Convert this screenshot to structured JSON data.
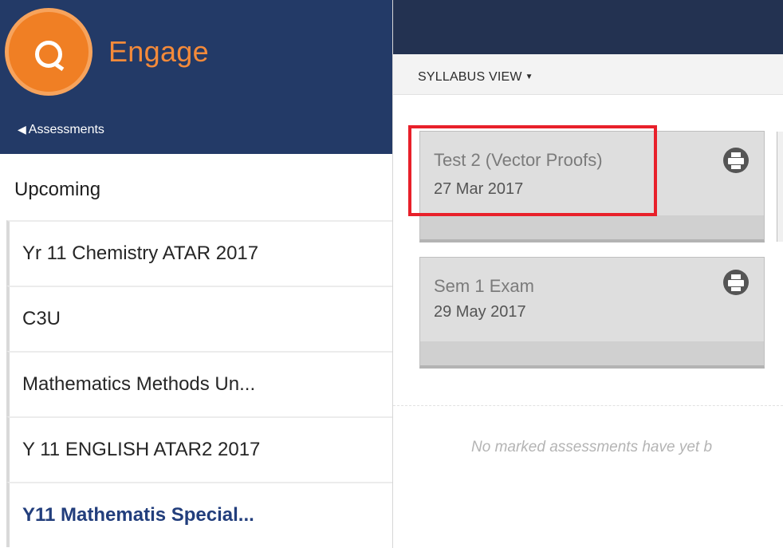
{
  "sidebar": {
    "brand": {
      "name": "Engage",
      "logo_icon": "q-logo-icon",
      "brand_color": "#f07f24"
    },
    "back_link": {
      "label": "Assessments",
      "icon": "triangle-left-icon"
    },
    "section_heading": "Upcoming",
    "courses": [
      {
        "label": "Yr 11 Chemistry ATAR 2017",
        "active": false
      },
      {
        "label": "C3U",
        "active": false
      },
      {
        "label": "Mathematics Methods Un...",
        "active": false
      },
      {
        "label": "Y 11 ENGLISH ATAR2 2017",
        "active": false
      },
      {
        "label": "Y11 Mathematis Special...",
        "active": true
      }
    ]
  },
  "toolbar": {
    "view_label": "SYLLABUS VIEW",
    "caret_icon": "caret-down-icon"
  },
  "assessments": [
    {
      "title": "Test 2 (Vector Proofs)",
      "date": "27 Mar 2017",
      "icon": "print-icon",
      "highlighted": true
    },
    {
      "title": "Sem 1 Exam",
      "date": "29 May 2017",
      "icon": "print-icon",
      "highlighted": false
    }
  ],
  "empty_message": "No marked assessments have yet b",
  "colors": {
    "sidebar_header": "#233a67",
    "topbar": "#233251",
    "highlight": "#e8202a",
    "active_course": "#223e7c"
  }
}
